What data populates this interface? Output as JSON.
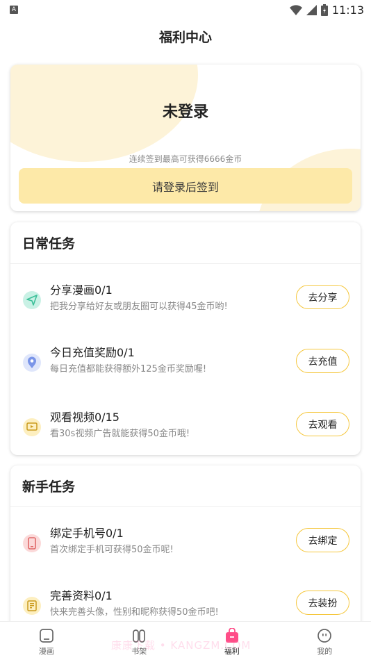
{
  "status_bar": {
    "left_icon": "A",
    "time": "11:13"
  },
  "page_title": "福利中心",
  "signin": {
    "user_name": "未登录",
    "hint": "连续签到最高可获得6666金币",
    "button_label": "请登录后签到"
  },
  "daily": {
    "title": "日常任务",
    "tasks": [
      {
        "name": "分享漫画0/1",
        "desc": "把我分享给好友或朋友圈可以获得45金币哟!",
        "button": "去分享",
        "icon": "send-icon",
        "icon_color": "#6fdcc0"
      },
      {
        "name": "今日充值奖励0/1",
        "desc": "每日充值都能获得额外125金币奖励喔!",
        "button": "去充值",
        "icon": "location-pin-icon",
        "icon_color": "#9fb4f0"
      },
      {
        "name": "观看视频0/15",
        "desc": "看30s视频广告就能获得50金币哦!",
        "button": "去观看",
        "icon": "video-icon",
        "icon_color": "#f7d46a"
      }
    ]
  },
  "newbie": {
    "title": "新手任务",
    "tasks": [
      {
        "name": "绑定手机号0/1",
        "desc": "首次绑定手机可获得50金币呢!",
        "button": "去绑定",
        "icon": "phone-icon",
        "icon_color": "#f5a0a0"
      },
      {
        "name": "完善资料0/1",
        "desc": "快来完善头像，性别和昵称获得50金币吧!",
        "button": "去装扮",
        "icon": "profile-card-icon",
        "icon_color": "#f7d46a"
      }
    ]
  },
  "tabbar": {
    "tabs": [
      {
        "label": "漫画",
        "icon": "comic-icon"
      },
      {
        "label": "书架",
        "icon": "bookshelf-icon"
      },
      {
        "label": "福利",
        "icon": "gift-bag-icon",
        "active": true
      },
      {
        "label": "我的",
        "icon": "face-icon"
      }
    ]
  },
  "watermark": "康康下载 • KANGZM.COM",
  "colors": {
    "accent": "#f5c73d",
    "button_bg": "#fde9a8",
    "active_tab": "#ff4d88"
  }
}
